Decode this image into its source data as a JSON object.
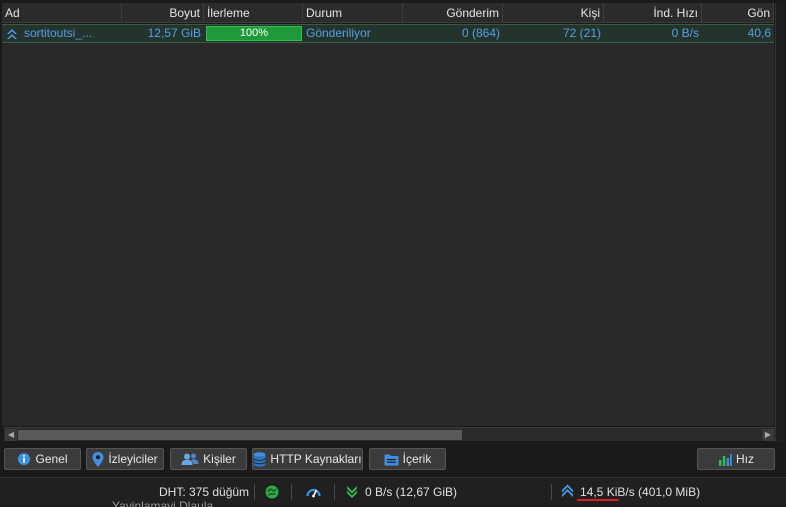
{
  "table": {
    "columns": [
      {
        "label": "Ad"
      },
      {
        "label": "Boyut"
      },
      {
        "label": "İlerleme"
      },
      {
        "label": "Durum"
      },
      {
        "label": "Gönderim"
      },
      {
        "label": "Kişi"
      },
      {
        "label": "İnd. Hızı"
      },
      {
        "label": "Gön"
      }
    ],
    "rows": [
      {
        "name": "sortitoutsi_...",
        "size": "12,57 GiB",
        "progress_text": "100%",
        "progress_value": 1.0,
        "status": "Gönderiliyor",
        "seeds": "0 (864)",
        "peers": "72 (21)",
        "down_speed": "0 B/s",
        "up_speed": "40,6"
      }
    ]
  },
  "tabs": {
    "general": "Genel",
    "trackers": "İzleyiciler",
    "peers": "Kişiler",
    "http_sources": "HTTP Kaynakları",
    "content": "İçerik",
    "speed": "Hız"
  },
  "statusbar": {
    "dht": "DHT: 375 düğüm",
    "download": "0 B/s (12,67 GiB)",
    "upload_rate": "14,5 KiB/s",
    "upload_total": "(401,0 MiB)"
  },
  "background_text": "Yayinlamayi Dlaula...",
  "colors": {
    "accent_blue": "#55a0e6",
    "progress_green": "#1f9a3a",
    "underline_red": "#e02020"
  }
}
